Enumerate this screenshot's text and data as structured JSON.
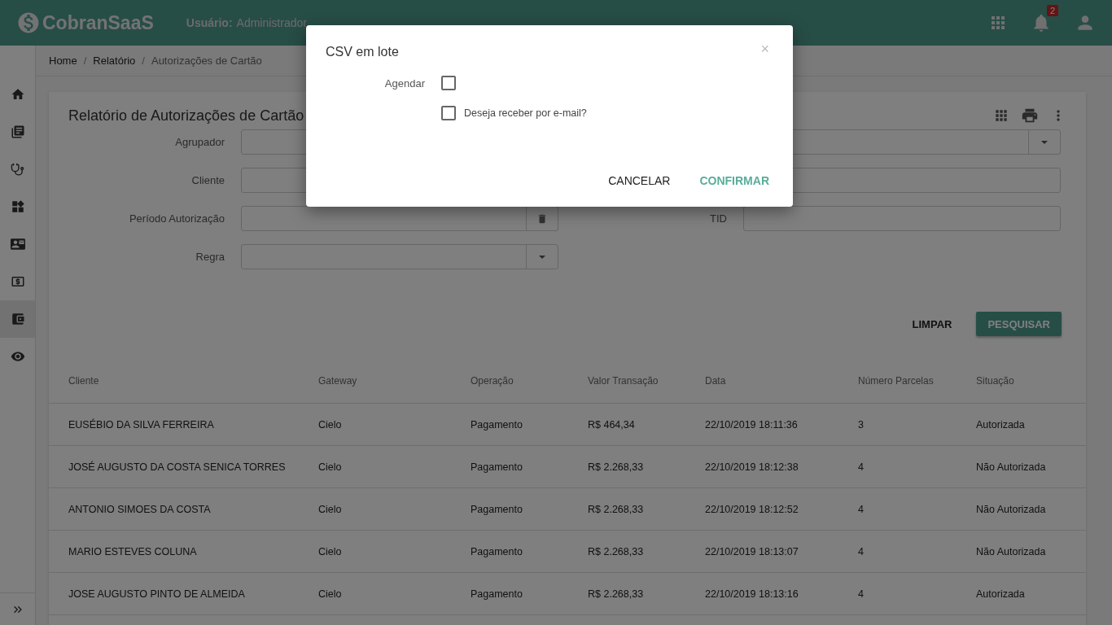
{
  "header": {
    "logo": "CobranSaaS",
    "user_label": "Usuário:",
    "user": "Administrador",
    "notification_count": "2"
  },
  "sidebar": {
    "items": [
      {
        "selected": false
      },
      {
        "selected": false
      },
      {
        "selected": false
      },
      {
        "selected": false
      },
      {
        "selected": false
      },
      {
        "selected": false
      },
      {
        "selected": true
      },
      {
        "selected": false
      }
    ]
  },
  "breadcrumb": [
    {
      "label": "Home"
    },
    {
      "separator": "/",
      "label": "Relatório"
    },
    {
      "separator": "/",
      "label": "Autorizações de Cartão"
    }
  ],
  "report": {
    "title": "Relatório de Autorizações de Cartão",
    "filters": [
      {
        "label": "Agrupador",
        "kind": "select",
        "wide": true
      },
      {
        "label": "Cliente",
        "kind": "text",
        "wide": true
      },
      {
        "label": "Período Autorização",
        "kind": "date",
        "wide": false
      },
      {
        "label": "TID",
        "kind": "text",
        "wide": false
      },
      {
        "label": "Regra",
        "kind": "select",
        "wide": false
      }
    ],
    "buttons": [
      {
        "label": "LIMPAR",
        "kind": "flat"
      },
      {
        "label": "PESQUISAR",
        "kind": "raised"
      }
    ]
  },
  "table": {
    "columns": [
      "Cliente",
      "Gateway",
      "Operação",
      "Valor Transação",
      "Data",
      "Número Parcelas",
      "Situação"
    ],
    "rows": [
      [
        "EUSÉBIO DA SILVA FERREIRA",
        "Cielo",
        "Pagamento",
        "R$ 464,34",
        "22/10/2019 18:11:36",
        "3",
        "Autorizada"
      ],
      [
        "JOSÉ AUGUSTO DA COSTA SENICA TORRES",
        "Cielo",
        "Pagamento",
        "R$ 2.268,33",
        "22/10/2019 18:12:38",
        "4",
        "Não Autorizada"
      ],
      [
        "ANTONIO SIMOES DA COSTA",
        "Cielo",
        "Pagamento",
        "R$ 2.268,33",
        "22/10/2019 18:12:52",
        "4",
        "Não Autorizada"
      ],
      [
        "MARIO ESTEVES COLUNA",
        "Cielo",
        "Pagamento",
        "R$ 2.268,33",
        "22/10/2019 18:13:07",
        "4",
        "Não Autorizada"
      ],
      [
        "JOSE AUGUSTO PINTO DE ALMEIDA",
        "Cielo",
        "Pagamento",
        "R$ 2.268,33",
        "22/10/2019 18:13:16",
        "4",
        "Autorizada"
      ]
    ]
  },
  "modal": {
    "title": "CSV em lote",
    "close": "×",
    "options": [
      {
        "kind": "labeled",
        "label": "Agendar",
        "checked": false
      },
      {
        "kind": "inline",
        "label": "Deseja receber por e-mail?",
        "checked": false
      }
    ],
    "buttons": [
      {
        "label": "CANCELAR",
        "kind": "flat"
      },
      {
        "label": "CONFIRMAR",
        "kind": "primary"
      }
    ]
  }
}
